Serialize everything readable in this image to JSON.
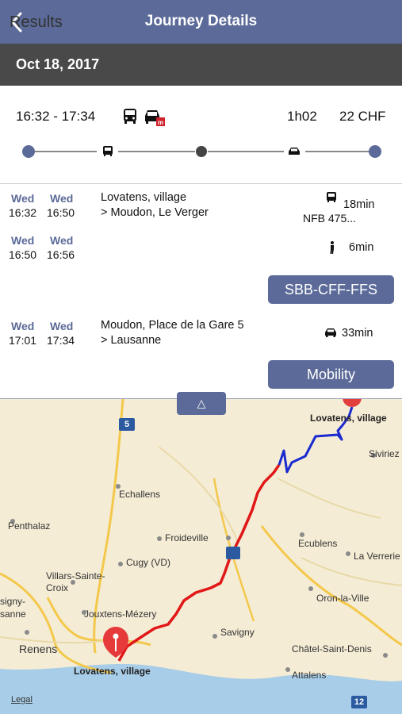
{
  "navbar": {
    "back_label": "Results",
    "title": "Journey Details",
    "color": "#5b6a98"
  },
  "date": "Oct 18, 2017",
  "summary": {
    "time_range": "16:32 - 17:34",
    "duration": "1h02",
    "price": "22 CHF",
    "icons": [
      "bus-icon",
      "car-icon"
    ],
    "timeline_icons": [
      "bus-icon",
      "car-icon"
    ]
  },
  "segments": [
    {
      "dep_day": "Wed",
      "dep_time": "16:32",
      "arr_day": "Wed",
      "arr_time": "16:50",
      "from": "Lovatens, village",
      "to": "> Moudon, Le Verger",
      "icon": "bus-icon",
      "duration": "18min",
      "service": "NFB 475..."
    },
    {
      "dep_day": "Wed",
      "dep_time": "16:50",
      "arr_day": "Wed",
      "arr_time": "16:56",
      "icon": "walk-icon",
      "duration": "6min"
    },
    {
      "dep_day": "Wed",
      "dep_time": "17:01",
      "arr_day": "Wed",
      "arr_time": "17:34",
      "from": "Moudon, Place de la Gare 5",
      "to": "> Lausanne",
      "icon": "car-icon",
      "duration": "33min"
    }
  ],
  "buttons": {
    "sbb": "SBB-CFF-FFS",
    "mobility": "Mobility"
  },
  "map": {
    "handle": "△",
    "legal": "Legal",
    "places": [
      "Lovatens, village",
      "Siviriez",
      "Echallens",
      "Penthalaz",
      "Froideville",
      "Ecublens",
      "La Verrerie",
      "Cugy (VD)",
      "Villars-Sainte-Croix",
      "Oron-la-Ville",
      "signy-",
      "sanne",
      "Jouxtens-Mézery",
      "Renens",
      "Savigny",
      "Châtel-Saint-Denis",
      "Attalens"
    ],
    "start_label": "Lovatens, village",
    "end_label": "Lovatens, village",
    "road_shields": [
      "5",
      "12"
    ],
    "route_colors": {
      "bus": "#1a2ad0",
      "car": "#e01818"
    }
  }
}
